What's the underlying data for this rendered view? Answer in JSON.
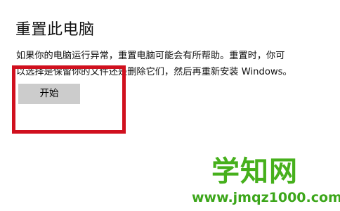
{
  "section": {
    "title": "重置此电脑",
    "description_line1": "如果你的电脑运行异常，重置电脑可能会有所帮助。重置时，你可",
    "description_line2": "以选择是保留你的文件还是删除它们，然后再重新安装 Windows。",
    "start_button_label": "开始"
  },
  "watermark": {
    "logo_text": "学知网",
    "url": "www.jmqz1000.com"
  },
  "colors": {
    "highlight_border": "#d0101e",
    "button_bg": "#cccccc",
    "watermark_green": "#46b01c"
  }
}
